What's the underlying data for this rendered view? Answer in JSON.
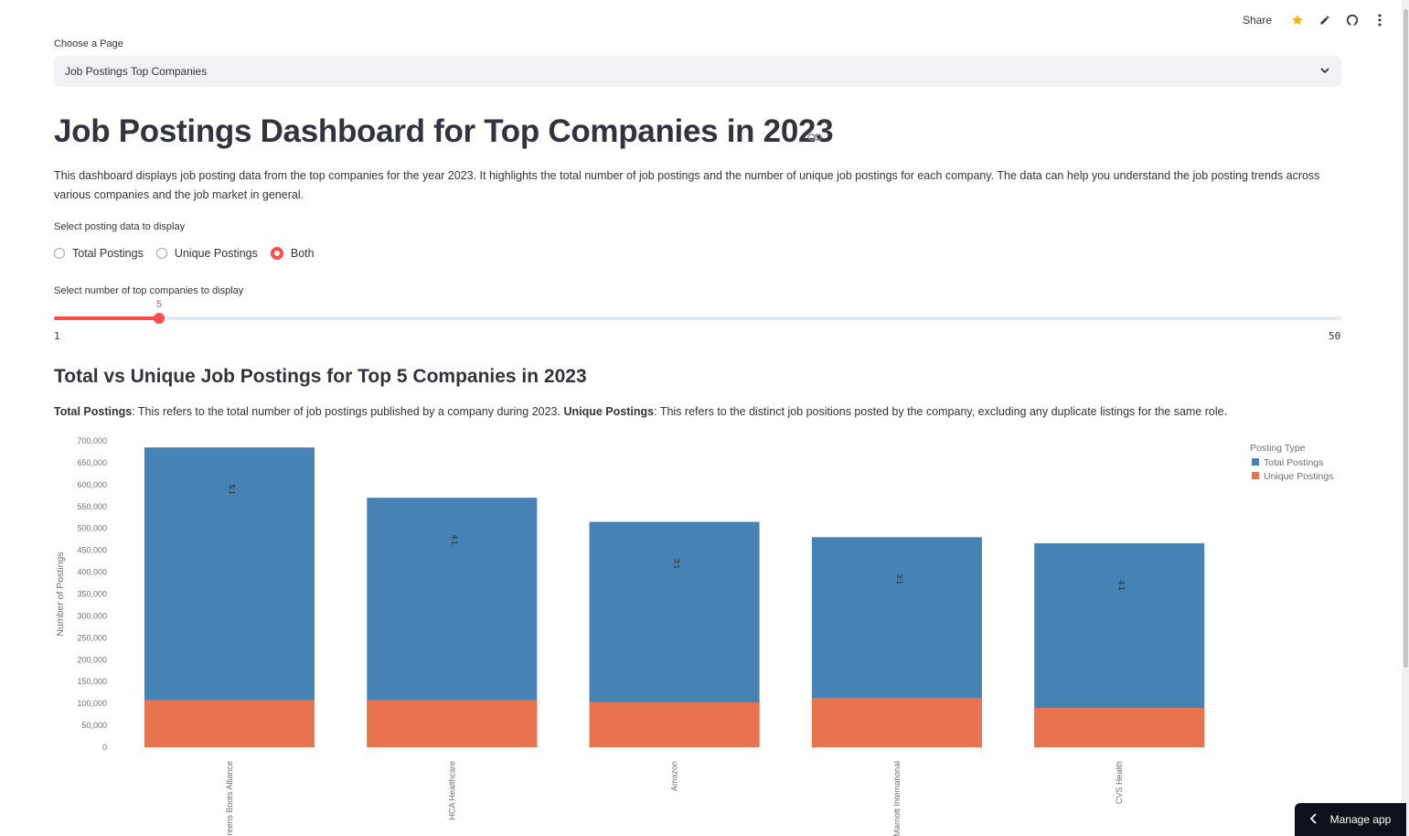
{
  "toolbar": {
    "share": "Share"
  },
  "page_select": {
    "label": "Choose a Page",
    "value": "Job Postings Top Companies"
  },
  "title": "Job Postings Dashboard for Top Companies in 2023",
  "description": "This dashboard displays job posting data from the top companies for the year 2023. It highlights the total number of job postings and the number of unique job postings for each company. The data can help you understand the job posting trends across various companies and the job market in general.",
  "radio": {
    "label": "Select posting data to display",
    "options": [
      "Total Postings",
      "Unique Postings",
      "Both"
    ],
    "selected": "Both"
  },
  "slider": {
    "label": "Select number of top companies to display",
    "min": 1,
    "max": 50,
    "value": 5,
    "min_label": "1",
    "max_label": "50",
    "value_label": "5"
  },
  "subheader": "Total vs Unique Job Postings for Top 5 Companies in 2023",
  "note": {
    "term1": "Total Postings",
    "text1": ": This refers to the total number of job postings published by a company during 2023. ",
    "term2": "Unique Postings",
    "text2": ": This refers to the distinct job positions posted by the company, excluding any duplicate listings for the same role."
  },
  "colors": {
    "accent": "#ff4b4b",
    "total": "#4682b4",
    "unique": "#e8734e"
  },
  "chart_data": {
    "type": "bar",
    "stacked": true,
    "categories": [
      "Walgreens Boots Alliance",
      "HCA Healthcare",
      "Amazon",
      "Marriott International",
      "CVS Health"
    ],
    "series": [
      {
        "name": "Total Postings",
        "values": [
          685000,
          570000,
          515000,
          480000,
          466000
        ]
      },
      {
        "name": "Unique Postings",
        "values": [
          108000,
          108000,
          103000,
          113000,
          90000
        ]
      }
    ],
    "bar_labels": [
      "5:1",
      "4:1",
      "3:1",
      "3:1",
      "4:1"
    ],
    "ylabel": "Number of Postings",
    "xlabel": "",
    "ylim": [
      0,
      700000
    ],
    "yticks": [
      0,
      50000,
      100000,
      150000,
      200000,
      250000,
      300000,
      350000,
      400000,
      450000,
      500000,
      550000,
      600000,
      650000,
      700000
    ],
    "legend_title": "Posting Type",
    "legend_position": "top-right",
    "grid": false
  },
  "manage_app": "Manage app"
}
